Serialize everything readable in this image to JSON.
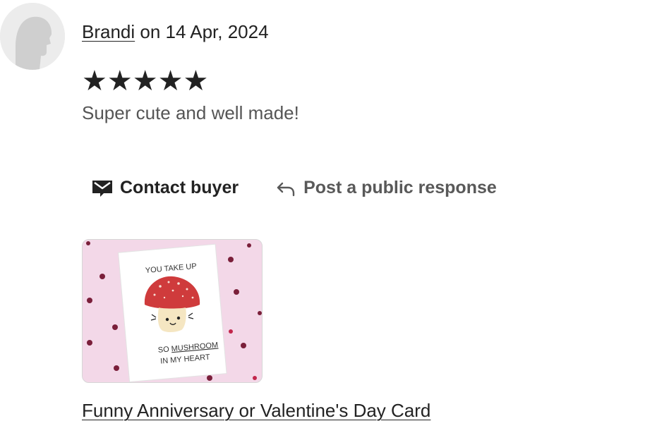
{
  "review": {
    "reviewer_name": "Brandi",
    "date_text": " on 14 Apr, 2024",
    "stars": "★★★★★",
    "rating": 5,
    "max_rating": 5,
    "text": "Super cute and well made!"
  },
  "actions": {
    "contact_label": "Contact buyer",
    "respond_label": "Post a public response"
  },
  "product": {
    "title": "Funny Anniversary or Valentine's Day Card",
    "card_line1": "YOU TAKE UP",
    "card_line2a": "SO ",
    "card_line2b": "MUSHROOM",
    "card_line3": "IN MY HEART"
  },
  "icons": {
    "avatar": "default-user-avatar-icon",
    "contact": "mail-icon",
    "respond": "reply-arrow-icon"
  }
}
